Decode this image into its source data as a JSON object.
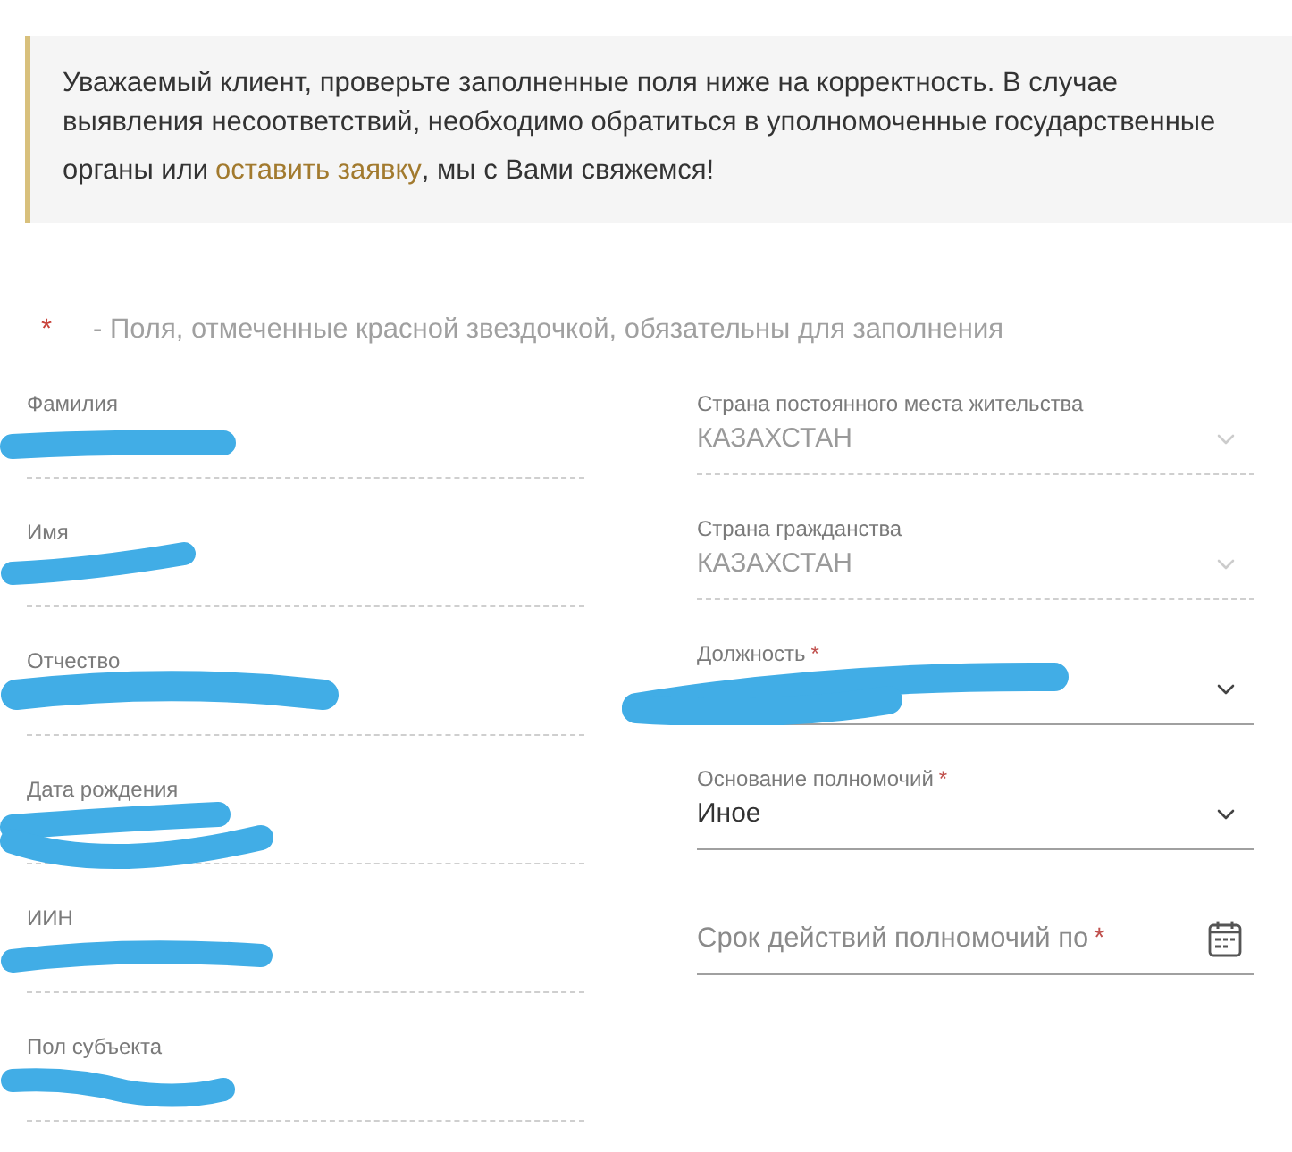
{
  "notice": {
    "text": "Уважаемый клиент, проверьте заполненные поля ниже на корректность. В случае выявления несоответствий, необходимо обратиться в уполномоченные государственные органы или",
    "link": "оставить заявку",
    "text_end": ", мы с Вами свяжемся!"
  },
  "required_note": {
    "mark": "*",
    "text": "- Поля, отмеченные красной звездочкой, обязательны для заполнения"
  },
  "left_fields": [
    {
      "kind": "text",
      "label": "Фамилия",
      "disabled": true,
      "redacted": true
    },
    {
      "kind": "text",
      "label": "Имя",
      "disabled": true,
      "redacted": true
    },
    {
      "kind": "text",
      "label": "Отчество",
      "disabled": true,
      "redacted": true
    },
    {
      "kind": "text",
      "label": "Дата рождения",
      "disabled": true,
      "redacted": true
    },
    {
      "kind": "text",
      "label": "ИИН",
      "disabled": true,
      "redacted": true
    },
    {
      "kind": "text",
      "label": "Пол субъекта",
      "disabled": true,
      "redacted": true
    }
  ],
  "right_fields": [
    {
      "kind": "select",
      "label": "Страна постоянного места жительства",
      "value": "КАЗАХСТАН",
      "disabled": true,
      "redacted": false
    },
    {
      "kind": "select",
      "label": "Страна гражданства",
      "value": "КАЗАХСТАН",
      "disabled": true,
      "redacted": false
    },
    {
      "kind": "select",
      "label": "Должность",
      "required_mark": "*",
      "disabled": false,
      "redacted": true
    },
    {
      "kind": "select",
      "label": "Основание полномочий",
      "required_mark": "*",
      "value": "Иное",
      "disabled": false,
      "redacted": false
    },
    {
      "kind": "date",
      "placeholder": "Срок действий полномочий по",
      "required_mark": "*",
      "disabled": false,
      "redacted": false
    }
  ]
}
